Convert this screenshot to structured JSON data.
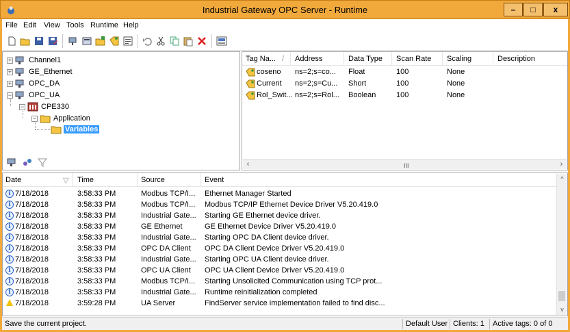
{
  "window": {
    "title": "Industrial Gateway OPC Server - Runtime",
    "min_label": "–",
    "max_label": "□",
    "close_label": "x"
  },
  "menu": [
    "File",
    "Edit",
    "View",
    "Tools",
    "Runtime",
    "Help"
  ],
  "toolbar": {
    "icons": [
      "new-project-icon",
      "open-project-icon",
      "save-icon",
      "save-as-icon",
      "new-channel-icon",
      "new-device-icon",
      "new-tag-group-icon",
      "new-tag-icon",
      "properties-icon",
      "undo-icon",
      "cut-icon",
      "copy-icon",
      "paste-icon",
      "delete-icon",
      "quick-client-icon"
    ]
  },
  "tree": {
    "nodes": [
      {
        "label": "Channel1",
        "toggle": "+"
      },
      {
        "label": "GE_Ethernet",
        "toggle": "+"
      },
      {
        "label": "OPC_DA",
        "toggle": "+"
      },
      {
        "label": "OPC_UA",
        "toggle": "−"
      },
      {
        "label": "CPE330",
        "toggle": "−"
      },
      {
        "label": "Application",
        "toggle": "−"
      },
      {
        "label": "Variables",
        "toggle": ""
      }
    ]
  },
  "tags": {
    "columns": [
      "Tag Na...",
      "/",
      "Address",
      "Data Type",
      "Scan Rate",
      "Scaling",
      "Description"
    ],
    "rows": [
      {
        "name": "coseno",
        "address": "ns=2;s=co...",
        "type": "Float",
        "scan": "100",
        "scaling": "None",
        "desc": ""
      },
      {
        "name": "Current",
        "address": "ns=2;s=Cu...",
        "type": "Short",
        "scan": "100",
        "scaling": "None",
        "desc": ""
      },
      {
        "name": "Rol_Swit...",
        "address": "ns=2;s=Rol...",
        "type": "Boolean",
        "scan": "100",
        "scaling": "None",
        "desc": ""
      }
    ],
    "scroll_thumb": "III"
  },
  "log": {
    "columns": [
      "Date",
      "Time",
      "Source",
      "Event"
    ],
    "rows": [
      {
        "level": "info",
        "date": "7/18/2018",
        "time": "3:58:33 PM",
        "source": "Modbus TCP/I...",
        "event": "Ethernet Manager Started"
      },
      {
        "level": "info",
        "date": "7/18/2018",
        "time": "3:58:33 PM",
        "source": "Modbus TCP/I...",
        "event": "Modbus TCP/IP Ethernet Device Driver V5.20.419.0"
      },
      {
        "level": "info",
        "date": "7/18/2018",
        "time": "3:58:33 PM",
        "source": "Industrial Gate...",
        "event": "Starting GE Ethernet device driver."
      },
      {
        "level": "info",
        "date": "7/18/2018",
        "time": "3:58:33 PM",
        "source": "GE Ethernet",
        "event": "GE Ethernet Device Driver V5.20.419.0"
      },
      {
        "level": "info",
        "date": "7/18/2018",
        "time": "3:58:33 PM",
        "source": "Industrial Gate...",
        "event": "Starting OPC DA Client device driver."
      },
      {
        "level": "info",
        "date": "7/18/2018",
        "time": "3:58:33 PM",
        "source": "OPC DA Client",
        "event": "OPC DA Client Device Driver V5.20.419.0"
      },
      {
        "level": "info",
        "date": "7/18/2018",
        "time": "3:58:33 PM",
        "source": "Industrial Gate...",
        "event": "Starting OPC UA Client device driver."
      },
      {
        "level": "info",
        "date": "7/18/2018",
        "time": "3:58:33 PM",
        "source": "OPC UA Client",
        "event": "OPC UA Client Device Driver V5.20.419.0"
      },
      {
        "level": "info",
        "date": "7/18/2018",
        "time": "3:58:33 PM",
        "source": "Modbus TCP/I...",
        "event": "Starting Unsolicited Communication using TCP prot..."
      },
      {
        "level": "info",
        "date": "7/18/2018",
        "time": "3:58:33 PM",
        "source": "Industrial Gate...",
        "event": "Runtime reinitialization completed"
      },
      {
        "level": "warning",
        "date": "7/18/2018",
        "time": "3:59:28 PM",
        "source": "UA Server",
        "event": "FindServer service implementation failed to find disc..."
      }
    ]
  },
  "status": {
    "message": "Save the current project.",
    "user": "Default User",
    "clients": "Clients: 1",
    "active_tags": "Active tags: 0 of 0"
  },
  "colors": {
    "title_bar": "#f2a93c",
    "selection": "#3399ff",
    "info_icon": "#2a62c9",
    "warning_icon": "#f3c300"
  }
}
